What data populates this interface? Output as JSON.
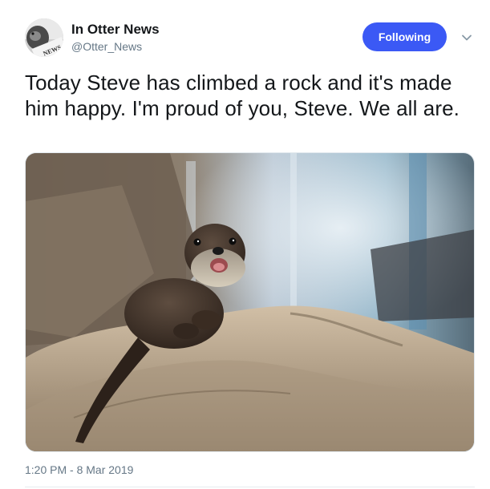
{
  "author": {
    "name": "In Otter News",
    "handle": "@Otter_News",
    "avatar_badge": "NEWS",
    "avatar_icon": "otter-news-avatar"
  },
  "follow_button": {
    "label": "Following",
    "color": "#3b59f5"
  },
  "menu": {
    "icon": "chevron-down-icon"
  },
  "tweet": {
    "text": "Today Steve has climbed a rock and it's made him happy. I'm proud of you, Steve. We all are.",
    "timestamp": "1:20 PM - 8 Mar 2019"
  },
  "media": {
    "icon": "photo-otter-on-rock"
  }
}
